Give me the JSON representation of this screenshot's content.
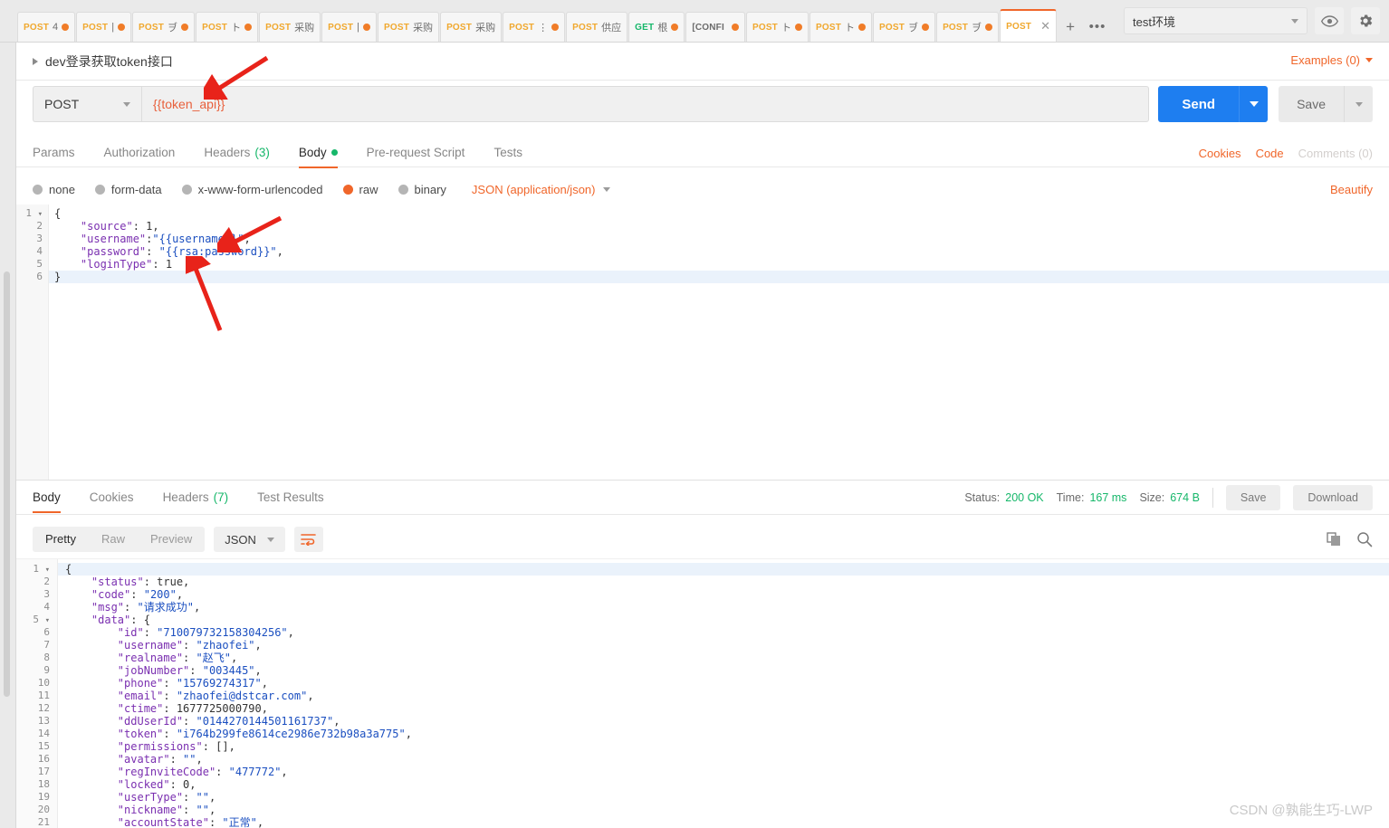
{
  "tabbar": {
    "tabs": [
      {
        "method": "POST",
        "label": "4",
        "dirty": true
      },
      {
        "method": "POST",
        "label": "|",
        "dirty": true
      },
      {
        "method": "POST",
        "label": "ヺ",
        "dirty": true
      },
      {
        "method": "POST",
        "label": "ト",
        "dirty": true
      },
      {
        "method": "POST",
        "label": "采购",
        "dirty": false
      },
      {
        "method": "POST",
        "label": "|",
        "dirty": true
      },
      {
        "method": "POST",
        "label": "采购",
        "dirty": false
      },
      {
        "method": "POST",
        "label": "采购",
        "dirty": false
      },
      {
        "method": "POST",
        "label": "⋮",
        "dirty": true
      },
      {
        "method": "POST",
        "label": "供应",
        "dirty": false
      },
      {
        "method": "GET",
        "label": "根",
        "dirty": true
      },
      {
        "method": "[CONFI",
        "label": "",
        "dirty": true
      },
      {
        "method": "POST",
        "label": "ト",
        "dirty": true
      },
      {
        "method": "POST",
        "label": "ト",
        "dirty": true
      },
      {
        "method": "POST",
        "label": "ヺ",
        "dirty": true
      },
      {
        "method": "POST",
        "label": "ヺ",
        "dirty": true
      }
    ],
    "active_tab": {
      "method": "POST",
      "close": "✕"
    },
    "new_tab_label": "+",
    "more_label": "•••"
  },
  "environment": {
    "selected": "test环境",
    "eye_icon": "eye-icon",
    "gear_icon": "gear-icon"
  },
  "request": {
    "name": "dev登录获取token接口",
    "examples_label": "Examples (0)",
    "method": "POST",
    "url": "{{token_api}}",
    "send_label": "Send",
    "save_label": "Save",
    "tabs": [
      {
        "label": "Params",
        "count": "",
        "active": false
      },
      {
        "label": "Authorization",
        "count": "",
        "active": false
      },
      {
        "label": "Headers",
        "count": "(3)",
        "active": false
      },
      {
        "label": "Body",
        "count": "",
        "active": true
      },
      {
        "label": "Pre-request Script",
        "count": "",
        "active": false
      },
      {
        "label": "Tests",
        "count": "",
        "active": false
      }
    ],
    "links": {
      "cookies": "Cookies",
      "code": "Code",
      "comments": "Comments (0)"
    },
    "body_types": [
      {
        "label": "none",
        "selected": false
      },
      {
        "label": "form-data",
        "selected": false
      },
      {
        "label": "x-www-form-urlencoded",
        "selected": false
      },
      {
        "label": "raw",
        "selected": true
      },
      {
        "label": "binary",
        "selected": false
      }
    ],
    "content_type": "JSON (application/json)",
    "beautify_label": "Beautify",
    "body_lines": [
      {
        "n": "1",
        "fold": true,
        "text": "{"
      },
      {
        "n": "2",
        "fold": false,
        "text": "    \"source\": 1,"
      },
      {
        "n": "3",
        "fold": false,
        "text": "    \"username\":\"{{username}}\","
      },
      {
        "n": "4",
        "fold": false,
        "text": "    \"password\": \"{{rsa:password}}\","
      },
      {
        "n": "5",
        "fold": false,
        "text": "    \"loginType\": 1"
      },
      {
        "n": "6",
        "fold": false,
        "text": "}"
      }
    ]
  },
  "response": {
    "tabs": [
      {
        "label": "Body",
        "count": "",
        "active": true
      },
      {
        "label": "Cookies",
        "count": "",
        "active": false
      },
      {
        "label": "Headers",
        "count": "(7)",
        "active": false
      },
      {
        "label": "Test Results",
        "count": "",
        "active": false
      }
    ],
    "status_label": "Status:",
    "status_value": "200 OK",
    "time_label": "Time:",
    "time_value": "167 ms",
    "size_label": "Size:",
    "size_value": "674 B",
    "save_label": "Save",
    "download_label": "Download",
    "view_modes": [
      {
        "label": "Pretty",
        "active": true
      },
      {
        "label": "Raw",
        "active": false
      },
      {
        "label": "Preview",
        "active": false
      }
    ],
    "format": "JSON",
    "wrap_icon": "word-wrap-icon",
    "copy_icon": "copy-icon",
    "search_icon": "search-icon",
    "body_lines": [
      {
        "n": "1",
        "fold": true,
        "text": "{"
      },
      {
        "n": "2",
        "fold": false,
        "text": "    \"status\": true,"
      },
      {
        "n": "3",
        "fold": false,
        "text": "    \"code\": \"200\","
      },
      {
        "n": "4",
        "fold": false,
        "text": "    \"msg\": \"请求成功\","
      },
      {
        "n": "5",
        "fold": true,
        "text": "    \"data\": {"
      },
      {
        "n": "6",
        "fold": false,
        "text": "        \"id\": \"710079732158304256\","
      },
      {
        "n": "7",
        "fold": false,
        "text": "        \"username\": \"zhaofei\","
      },
      {
        "n": "8",
        "fold": false,
        "text": "        \"realname\": \"赵飞\","
      },
      {
        "n": "9",
        "fold": false,
        "text": "        \"jobNumber\": \"003445\","
      },
      {
        "n": "10",
        "fold": false,
        "text": "        \"phone\": \"15769274317\","
      },
      {
        "n": "11",
        "fold": false,
        "text": "        \"email\": \"zhaofei@dstcar.com\","
      },
      {
        "n": "12",
        "fold": false,
        "text": "        \"ctime\": 1677725000790,"
      },
      {
        "n": "13",
        "fold": false,
        "text": "        \"ddUserId\": \"0144270144501161737\","
      },
      {
        "n": "14",
        "fold": false,
        "text": "        \"token\": \"i764b299fe8614ce2986e732b98a3a775\","
      },
      {
        "n": "15",
        "fold": false,
        "text": "        \"permissions\": [],"
      },
      {
        "n": "16",
        "fold": false,
        "text": "        \"avatar\": \"\","
      },
      {
        "n": "17",
        "fold": false,
        "text": "        \"regInviteCode\": \"477772\","
      },
      {
        "n": "18",
        "fold": false,
        "text": "        \"locked\": 0,"
      },
      {
        "n": "19",
        "fold": false,
        "text": "        \"userType\": \"\","
      },
      {
        "n": "20",
        "fold": false,
        "text": "        \"nickname\": \"\","
      },
      {
        "n": "21",
        "fold": false,
        "text": "        \"accountState\": \"正常\","
      }
    ]
  },
  "watermark": "CSDN @孰能生巧-LWP",
  "colors": {
    "accent_orange": "#f0662a",
    "method_post": "#f0a82e",
    "method_get": "#16b76a",
    "send_blue": "#1e7ef0",
    "status_green": "#16b76a",
    "variable_red": "#e8603c"
  }
}
